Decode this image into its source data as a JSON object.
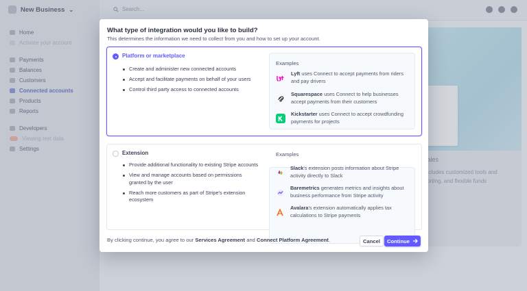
{
  "app": {
    "business_name": "New Business",
    "search_placeholder": "Search..."
  },
  "sidebar": {
    "items": [
      {
        "label": "Home",
        "state": "normal"
      },
      {
        "label": "Activate your account",
        "state": "faded"
      },
      {
        "label": "Payments",
        "state": "normal"
      },
      {
        "label": "Balances",
        "state": "normal"
      },
      {
        "label": "Customers",
        "state": "normal"
      },
      {
        "label": "Connected accounts",
        "state": "active"
      },
      {
        "label": "Products",
        "state": "normal"
      },
      {
        "label": "Reports",
        "state": "normal"
      },
      {
        "label": "Developers",
        "state": "normal"
      },
      {
        "label": "Viewing test data",
        "state": "faded"
      },
      {
        "label": "Settings",
        "state": "normal"
      }
    ]
  },
  "background": {
    "heading_fragment": "cales",
    "text_line_1": "includes customized tools and",
    "text_line_2": "porting, and flexible funds"
  },
  "modal": {
    "title": "What type of integration would you like to build?",
    "subtitle": "This determines the information we need to collect from you and how to set up your account.",
    "options": [
      {
        "title": "Platform or marketplace",
        "selected": true,
        "bullets": [
          "Create and administer new connected accounts",
          "Accept and facilitate payments on behalf of your users",
          "Control third party access to connected accounts"
        ],
        "examples_heading": "Examples",
        "examples": [
          {
            "icon": "lyft-icon",
            "color": "#ff00bf",
            "name": "Lyft",
            "text": " uses Connect to accept payments from riders and pay drivers"
          },
          {
            "icon": "squarespace-icon",
            "color": "#222222",
            "name": "Squarespace",
            "text": " uses Connect to help businesses accept payments from their customers"
          },
          {
            "icon": "kickstarter-icon",
            "color": "#05ce78",
            "name": "Kickstarter",
            "text": " uses Connect to accept crowdfunding payments for projects"
          }
        ]
      },
      {
        "title": "Extension",
        "selected": false,
        "bullets": [
          "Provide additional functionality to existing Stripe accounts",
          "View and manage accounts based on permissions granted by the user",
          "Reach more customers as part of Stripe's extension ecosystem"
        ],
        "examples_heading": "Examples",
        "examples": [
          {
            "icon": "slack-icon",
            "color": "#e01e5a",
            "name": "Slack",
            "text": "'s extension posts information about Stripe activity directly to Slack"
          },
          {
            "icon": "baremetrics-icon",
            "color": "#6e5ff1",
            "name": "Baremetrics",
            "text": " generates metrics and insights about business performance from Stripe activity"
          },
          {
            "icon": "avalara-icon",
            "color": "#f26e21",
            "name": "Avalara",
            "text": "'s extension automatically applies tax calculations to Stripe payments"
          }
        ]
      }
    ],
    "footer": {
      "prefix": "By clicking continue, you agree to our ",
      "link1": "Services Agreement",
      "middle": " and ",
      "link2": "Connect Platform Agreement",
      "suffix": "."
    },
    "cancel_label": "Cancel",
    "continue_label": "Continue",
    "accent_color": "#635bff"
  }
}
